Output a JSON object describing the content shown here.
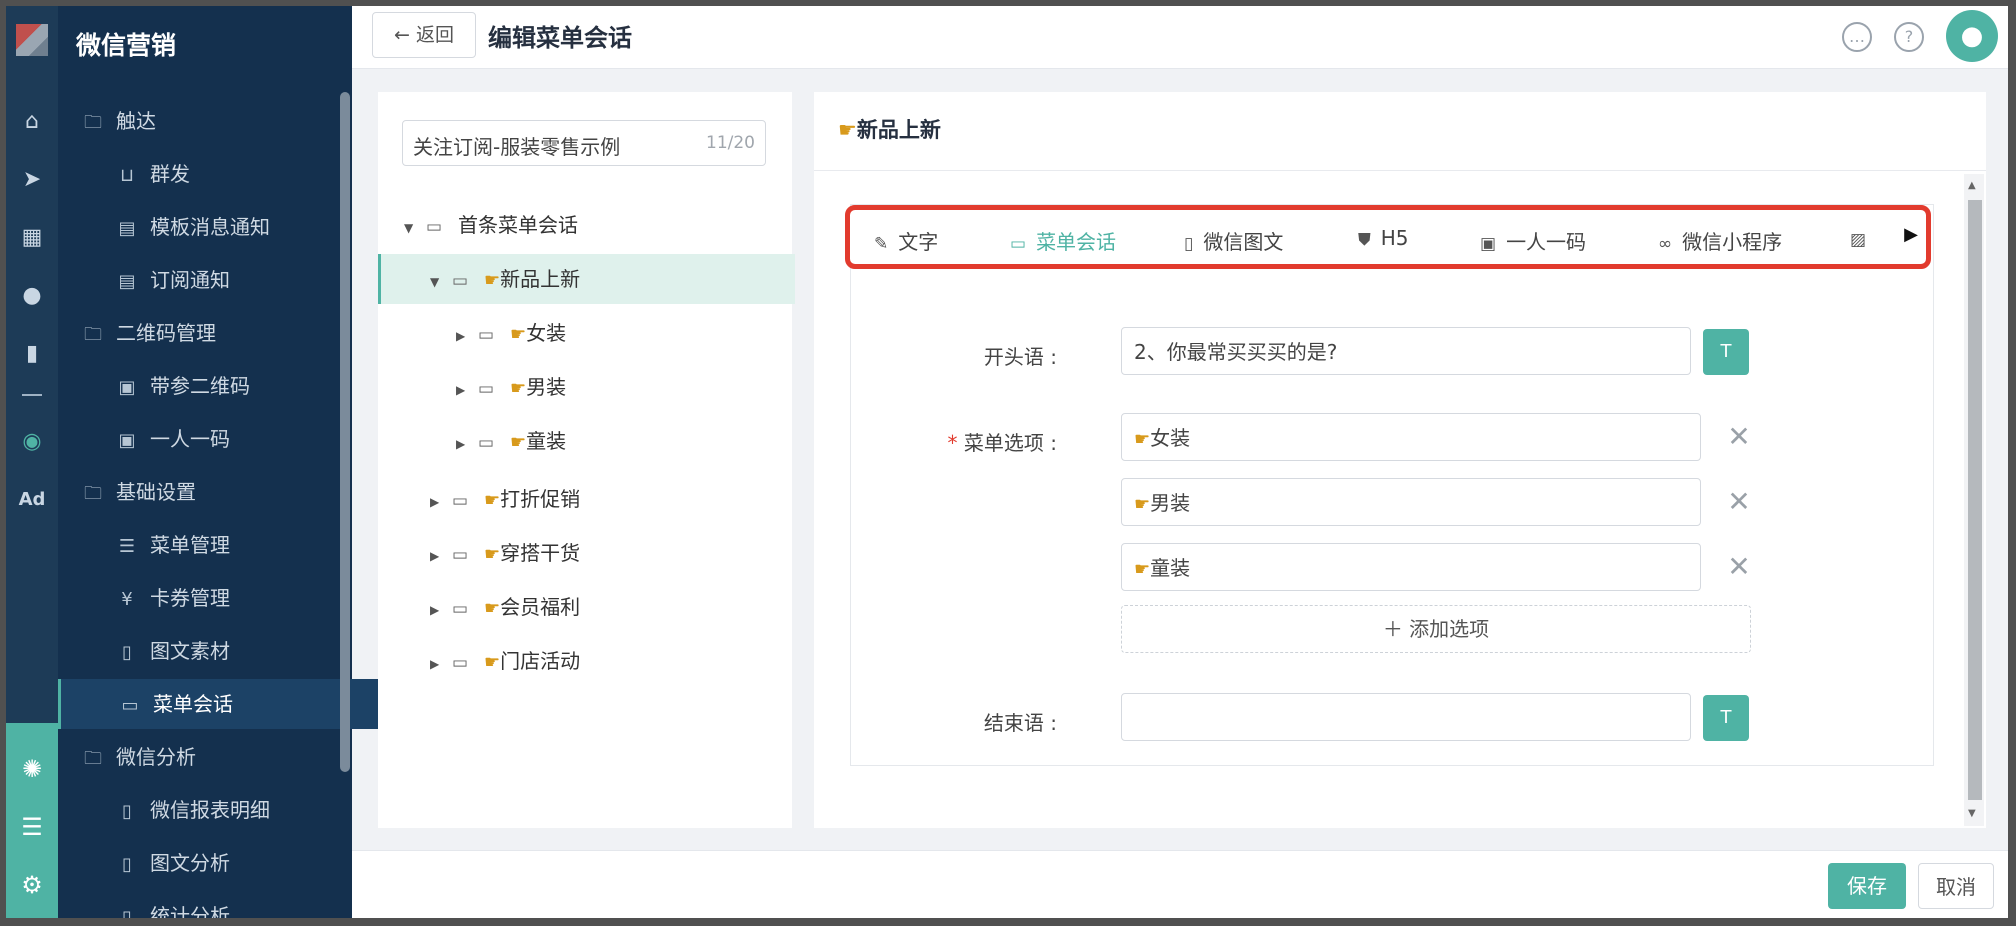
{
  "app_title": "微信营销",
  "header": {
    "back_label": "返回",
    "page_title": "编辑菜单会话"
  },
  "sidebar": {
    "items": [
      {
        "label": "触达",
        "icon": "folder-icon",
        "level": "group"
      },
      {
        "label": "群发",
        "icon": "broadcast-icon",
        "level": "sub"
      },
      {
        "label": "模板消息通知",
        "icon": "message-icon",
        "level": "sub"
      },
      {
        "label": "订阅通知",
        "icon": "message-icon",
        "level": "sub"
      },
      {
        "label": "二维码管理",
        "icon": "folder-icon",
        "level": "group"
      },
      {
        "label": "带参二维码",
        "icon": "qrcode-icon",
        "level": "sub"
      },
      {
        "label": "一人一码",
        "icon": "qrcode-icon",
        "level": "sub"
      },
      {
        "label": "基础设置",
        "icon": "folder-icon",
        "level": "group"
      },
      {
        "label": "菜单管理",
        "icon": "list-icon",
        "level": "sub"
      },
      {
        "label": "卡券管理",
        "icon": "coupon-icon",
        "level": "sub"
      },
      {
        "label": "图文素材",
        "icon": "document-icon",
        "level": "sub"
      },
      {
        "label": "菜单会话",
        "icon": "chat-icon",
        "level": "sub",
        "active": true
      },
      {
        "label": "微信分析",
        "icon": "folder-icon",
        "level": "group"
      },
      {
        "label": "微信报表明细",
        "icon": "document-icon",
        "level": "sub"
      },
      {
        "label": "图文分析",
        "icon": "document-icon",
        "level": "sub"
      },
      {
        "label": "统计分析",
        "icon": "document-icon",
        "level": "sub"
      }
    ]
  },
  "rail": {
    "icons": [
      "home-icon",
      "send-icon",
      "layout-icon",
      "user-icon",
      "bar-chart-icon",
      "wechat-icon"
    ],
    "ad_label": "Ad",
    "bottom_icons": [
      "network-icon",
      "server-icon",
      "settings-icon"
    ]
  },
  "tree": {
    "input_value": "关注订阅-服装零售示例",
    "input_count": "11/20",
    "nodes": [
      {
        "label": "首条菜单会话",
        "expanded": true,
        "hand": false
      },
      {
        "label": "新品上新",
        "expanded": true,
        "hand": true,
        "selected": true
      },
      {
        "label": "女装",
        "expanded": false,
        "hand": true
      },
      {
        "label": "男装",
        "expanded": false,
        "hand": true
      },
      {
        "label": "童装",
        "expanded": false,
        "hand": true
      },
      {
        "label": "打折促销",
        "expanded": false,
        "hand": true
      },
      {
        "label": "穿搭干货",
        "expanded": false,
        "hand": true
      },
      {
        "label": "会员福利",
        "expanded": false,
        "hand": true
      },
      {
        "label": "门店活动",
        "expanded": false,
        "hand": true
      }
    ]
  },
  "main": {
    "title": "新品上新",
    "toolbar": [
      {
        "label": "文字",
        "icon": "pencil-icon"
      },
      {
        "label": "菜单会话",
        "icon": "chat-icon",
        "active": true
      },
      {
        "label": "微信图文",
        "icon": "document-icon"
      },
      {
        "label": "H5",
        "icon": "html5-icon"
      },
      {
        "label": "一人一码",
        "icon": "qrcode-icon"
      },
      {
        "label": "微信小程序",
        "icon": "link-icon"
      }
    ],
    "form": {
      "opening_label": "开头语 :",
      "opening_value": "2、你最常买买买的是?",
      "options_label": "菜单选项 :",
      "options": [
        "女装",
        "男装",
        "童装"
      ],
      "add_option_label": "添加选项",
      "closing_label": "结束语 :",
      "closing_value": ""
    }
  },
  "footer": {
    "save_label": "保存",
    "cancel_label": "取消"
  },
  "colors": {
    "accent": "#4fb3a4",
    "sidebar_bg": "#14304e",
    "highlight_border": "#e23b2e"
  }
}
